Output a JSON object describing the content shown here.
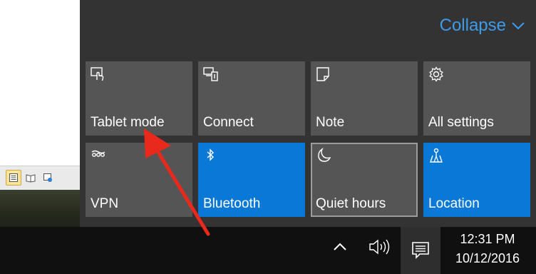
{
  "action_center": {
    "collapse_label": "Collapse",
    "colors": {
      "panel": "#333333",
      "tile_off": "#555555",
      "tile_on": "#0a78d7",
      "link": "#3d9be9"
    },
    "tiles": [
      {
        "label": "Tablet mode",
        "icon": "tablet-mode-icon",
        "state": "off"
      },
      {
        "label": "Connect",
        "icon": "connect-icon",
        "state": "off"
      },
      {
        "label": "Note",
        "icon": "note-icon",
        "state": "off"
      },
      {
        "label": "All settings",
        "icon": "gear-icon",
        "state": "off"
      },
      {
        "label": "VPN",
        "icon": "vpn-icon",
        "state": "off"
      },
      {
        "label": "Bluetooth",
        "icon": "bluetooth-icon",
        "state": "on"
      },
      {
        "label": "Quiet hours",
        "icon": "moon-icon",
        "state": "focused"
      },
      {
        "label": "Location",
        "icon": "location-icon",
        "state": "on"
      }
    ]
  },
  "taskbar": {
    "time": "12:31 PM",
    "date": "10/12/2016",
    "icons": [
      "show-hidden-icons-chevron",
      "volume-icon",
      "action-center-icon"
    ]
  },
  "annotation": {
    "type": "red-arrow",
    "points_to": "Tablet mode",
    "color": "#e8291c"
  }
}
